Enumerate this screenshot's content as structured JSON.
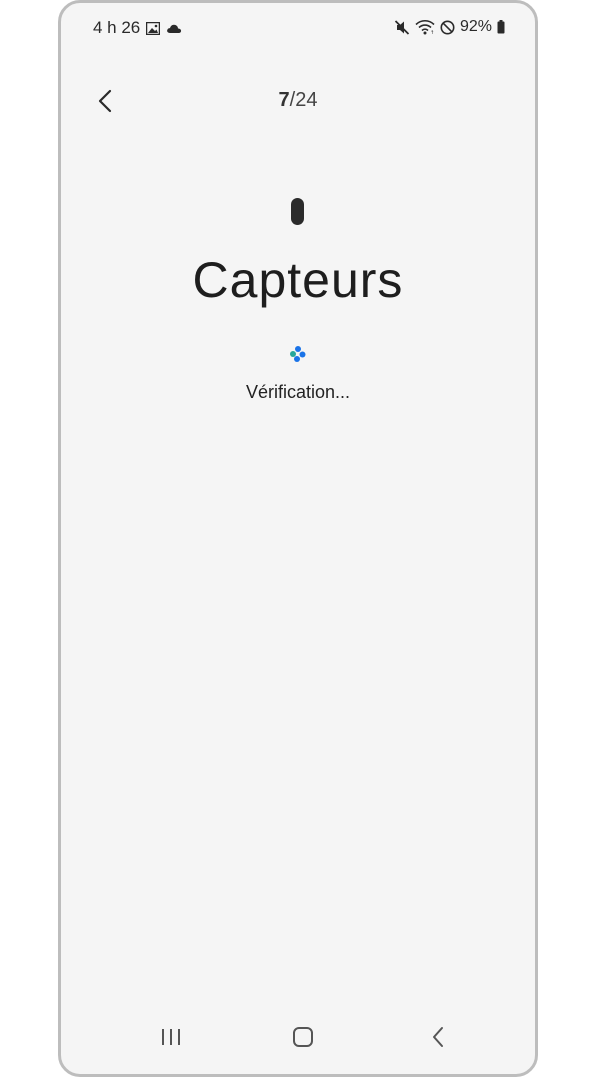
{
  "status_bar": {
    "time": "4 h 26",
    "battery": "92%",
    "icons": [
      "image-icon",
      "cloud-icon",
      "mute-icon",
      "wifi-icon",
      "do-not-disturb-icon",
      "battery-icon"
    ]
  },
  "header": {
    "current_step": "7",
    "total_steps": "/24"
  },
  "main": {
    "title": "Capteurs",
    "status_text": "Vérification..."
  },
  "colors": {
    "background": "#f5f5f5",
    "spinner_blue": "#1a73e8",
    "spinner_teal": "#26a69a"
  }
}
